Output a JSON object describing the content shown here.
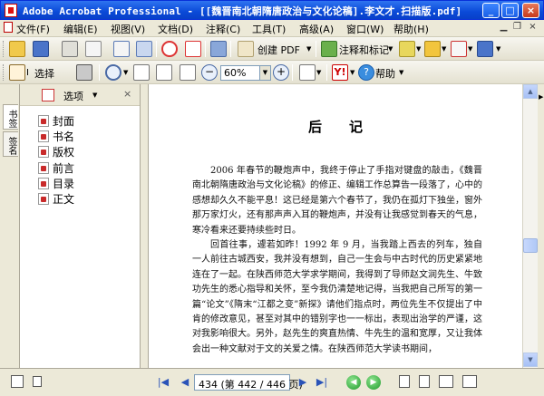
{
  "window": {
    "title": "Adobe Acrobat Professional - [[魏晋南北朝隋唐政治与文化论稿].李文才.扫描版.pdf]",
    "minimize_glyph": "_",
    "maximize_glyph": "□",
    "close_glyph": "×"
  },
  "menu": {
    "items": [
      "文件(F)",
      "编辑(E)",
      "视图(V)",
      "文档(D)",
      "注释(C)",
      "工具(T)",
      "高级(A)",
      "窗口(W)",
      "帮助(H)"
    ],
    "mdi_close": "×"
  },
  "toolbar1": {
    "create_pdf_label": "创建 PDF",
    "comment_label": "注释和标记"
  },
  "toolbar2": {
    "select_label": "选择",
    "zoom_value": "60%",
    "help_label": "帮助"
  },
  "side_tabs": {
    "bookmarks": "书签",
    "signatures": "签名"
  },
  "nav_panel": {
    "options_label": "选项",
    "bookmarks": [
      "封面",
      "书名",
      "版权",
      "前言",
      "目录",
      "正文"
    ]
  },
  "document": {
    "heading": "后记",
    "paragraphs": [
      "2006 年春节的鞭炮声中，我终于停止了手指对键盘的敲击，《魏晋南北朝隋唐政治与文化论稿》的修正、编辑工作总算告一段落了，心中的感想却久久不能平息！这已经是第六个春节了，我仍在孤灯下独坐，窗外那万家灯火，还有那声声入耳的鞭炮声，并没有让我感觉到春天的气息，寒冷看来还要持续些时日。",
      "回首往事，遽若如昨！1992 年 9 月，当我踏上西去的列车，独自一人前往古城西安，我并没有想到，自己一生会与中古时代的历史紧紧地连在了一起。在陕西师范大学求学期间，我得到了导师赵文润先生、牛致功先生的悉心指导和关怀，至今我仍清楚地记得，当我把自己所写的第一篇“论文”《隋末“江都之变”新探》请他们指点时，两位先生不仅提出了中肯的修改意见，甚至对其中的错别字也一一标出，表现出治学的严谨，这对我影响很大。另外，赵先生的爽直热情、牛先生的温和宽厚，又让我体会出一种文献对于文的关爱之情。在陕西师范大学读书期间，"
    ]
  },
  "status": {
    "page_display": "434 (第 442 / 446 页)"
  }
}
